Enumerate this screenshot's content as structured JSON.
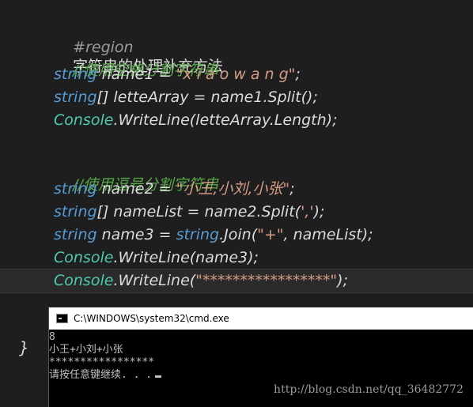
{
  "editor": {
    "region_kw": "#region",
    "region_title": "字符串的处理补充方法",
    "comment1": "//使用空格分割字符串",
    "l3": {
      "kw": "string",
      "rest": " name1 = ",
      "str": "\"x i a o w a n g\"",
      "end": ";"
    },
    "l4": {
      "kw": "string",
      "rest": "[] letteArray = name1.Split();"
    },
    "l5": {
      "cls": "Console",
      "rest": ".WriteLine(letteArray.Length);"
    },
    "comment2": "//使用逗号分割字符串",
    "l7": {
      "kw": "string",
      "rest": " name2 = ",
      "str": "\"小王,小刘,小张\"",
      "end": ";"
    },
    "l8": {
      "kw": "string",
      "rest": "[] nameList = name2.Split(",
      "str": "','",
      "end": ");"
    },
    "l9": {
      "kw": "string",
      "rest1": " name3 = ",
      "kw2": "string",
      "rest2": ".Join(",
      "str": "\"+\"",
      "end": ", nameList);"
    },
    "l10": {
      "cls": "Console",
      "rest": ".WriteLine(name3);"
    },
    "l11": {
      "cls": "Console",
      "rest": ".WriteLine(",
      "str": "\"*****************\"",
      "end": ");"
    },
    "brace": "}"
  },
  "console": {
    "title": "C:\\WINDOWS\\system32\\cmd.exe",
    "lines": [
      "8",
      "小王+小刘+小张",
      "*****************",
      "请按任意键继续. . ."
    ]
  },
  "watermark": "http://blog.csdn.net/qq_36482772"
}
